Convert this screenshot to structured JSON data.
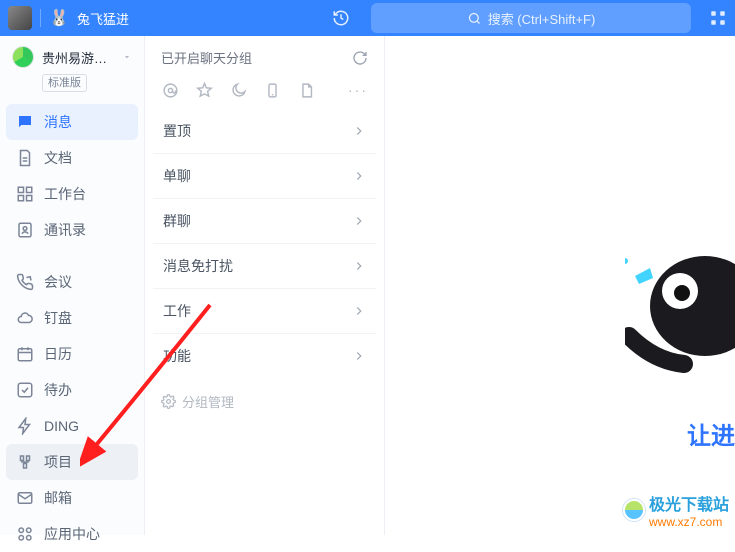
{
  "titlebar": {
    "title": "兔飞猛进",
    "search_placeholder": "搜索 (Ctrl+Shift+F)"
  },
  "org": {
    "name": "贵州易游…",
    "badge": "标准版"
  },
  "sidebar": {
    "items": [
      {
        "label": "消息"
      },
      {
        "label": "文档"
      },
      {
        "label": "工作台"
      },
      {
        "label": "通讯录"
      },
      {
        "label": "会议"
      },
      {
        "label": "钉盘"
      },
      {
        "label": "日历"
      },
      {
        "label": "待办"
      },
      {
        "label": "DING"
      },
      {
        "label": "项目"
      },
      {
        "label": "邮箱"
      },
      {
        "label": "应用中心"
      }
    ]
  },
  "mid": {
    "head": "已开启聊天分组",
    "manage": "分组管理",
    "groups": [
      {
        "label": "置顶"
      },
      {
        "label": "单聊"
      },
      {
        "label": "群聊"
      },
      {
        "label": "消息免打扰"
      },
      {
        "label": "工作"
      },
      {
        "label": "功能"
      }
    ]
  },
  "right": {
    "tagline": "让进"
  },
  "watermark": {
    "site_name": "极光下载站",
    "url": "www.xz7.com"
  }
}
